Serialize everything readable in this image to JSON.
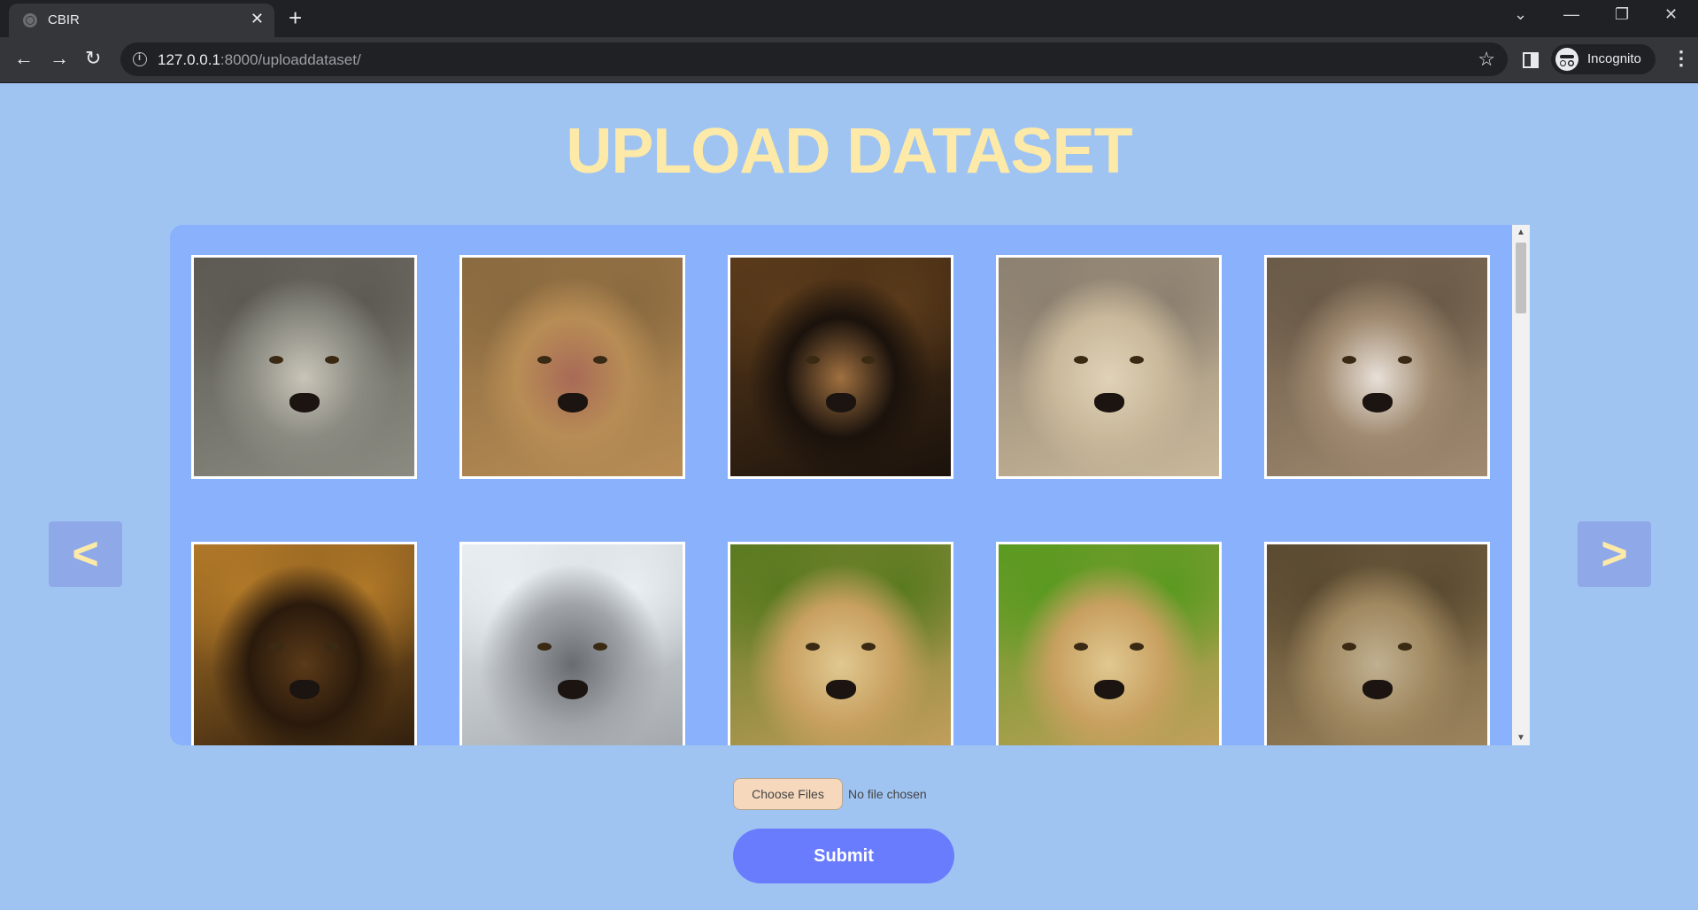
{
  "browser": {
    "tab_title": "CBIR",
    "url_host": "127.0.0.1",
    "url_rest": ":8000/uploaddataset/",
    "profile_label": "Incognito"
  },
  "page": {
    "title": "UPLOAD DATASET",
    "prev_label": "<",
    "next_label": ">",
    "choose_files_label": "Choose Files",
    "file_status": "No file chosen",
    "submit_label": "Submit"
  },
  "gallery": {
    "images": [
      {
        "subject": "wolf",
        "colors": [
          "#8b8b82",
          "#5c5a52",
          "#c9c4b8"
        ]
      },
      {
        "subject": "lion",
        "colors": [
          "#b88d55",
          "#8a6a40",
          "#a86a56"
        ]
      },
      {
        "subject": "lion",
        "colors": [
          "#1a120c",
          "#5a3a1a",
          "#a07040"
        ]
      },
      {
        "subject": "lioness",
        "colors": [
          "#c9b89a",
          "#8c8070",
          "#e0d2b8"
        ]
      },
      {
        "subject": "cheetah",
        "colors": [
          "#a08a70",
          "#6a5a48",
          "#e8e0d8"
        ]
      },
      {
        "subject": "leopard",
        "colors": [
          "#2a1a0c",
          "#b07828",
          "#5a3a18"
        ]
      },
      {
        "subject": "snow leopard",
        "colors": [
          "#a0a4a8",
          "#e8eef2",
          "#686c70"
        ]
      },
      {
        "subject": "cheetah",
        "colors": [
          "#c8a060",
          "#5a7a20",
          "#e0c890"
        ]
      },
      {
        "subject": "cheetah",
        "colors": [
          "#c8a060",
          "#5a9a20",
          "#e0c890"
        ]
      },
      {
        "subject": "jaguar",
        "colors": [
          "#a08860",
          "#5a4a30",
          "#c0b090"
        ]
      }
    ]
  }
}
